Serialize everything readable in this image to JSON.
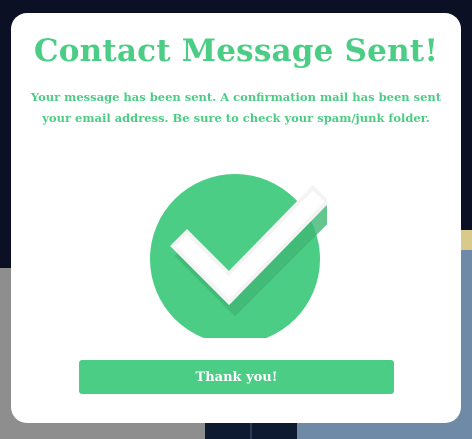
{
  "modal": {
    "title": "Contact Message Sent!",
    "message": "Your message has been sent. A confirmation mail has been sent your email address. Be sure to check your spam/junk folder.",
    "button_label": "Thank you!",
    "status_icon": "check-circle-icon"
  },
  "colors": {
    "accent": "#4ccd86",
    "modal_bg": "#ffffff",
    "backdrop": "#0b1024"
  }
}
